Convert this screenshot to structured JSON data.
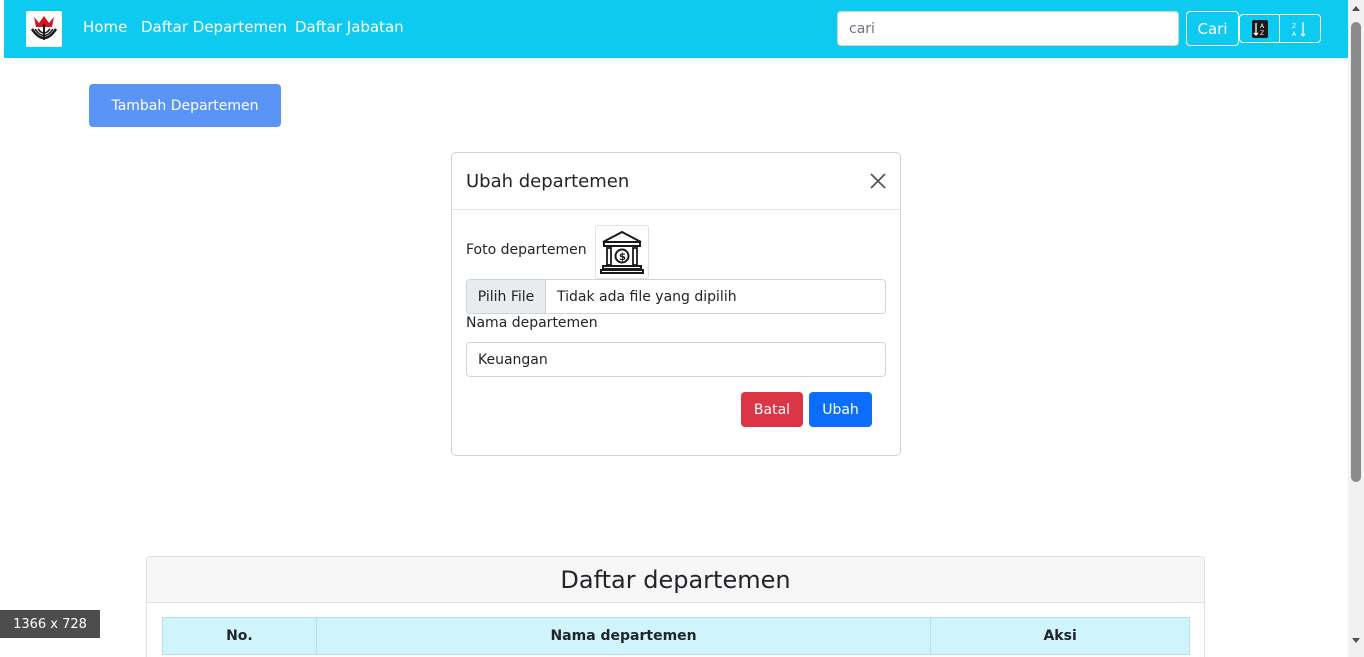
{
  "navbar": {
    "logo_icon": "university-logo-icon",
    "links": [
      "Home",
      "Daftar Departemen",
      "Daftar Jabatan"
    ],
    "search_placeholder": "cari",
    "search_button": "Cari",
    "sort_asc_icon": "sort-alpha-up-icon",
    "sort_desc_icon": "sort-alpha-down-icon"
  },
  "toolbar": {
    "add_button": "Tambah Departemen"
  },
  "modal": {
    "title": "Ubah departemen",
    "close_icon": "close-icon",
    "photo_label": "Foto departemen",
    "photo_icon": "bank-building-icon",
    "file_button": "Pilih File",
    "file_status": "Tidak ada file yang dipilih",
    "name_label": "Nama departemen",
    "name_value": "Keuangan",
    "cancel_button": "Batal",
    "submit_button": "Ubah"
  },
  "list_card": {
    "title": "Daftar departemen",
    "columns": [
      "No.",
      "Nama departemen",
      "Aksi"
    ]
  },
  "viewport_badge": "1366 x 728",
  "colors": {
    "navbar": "#0dcaf0",
    "add_button": "#5b94f7",
    "danger": "#dc3545",
    "primary": "#0d6efd",
    "table_header": "#cff4fc"
  }
}
